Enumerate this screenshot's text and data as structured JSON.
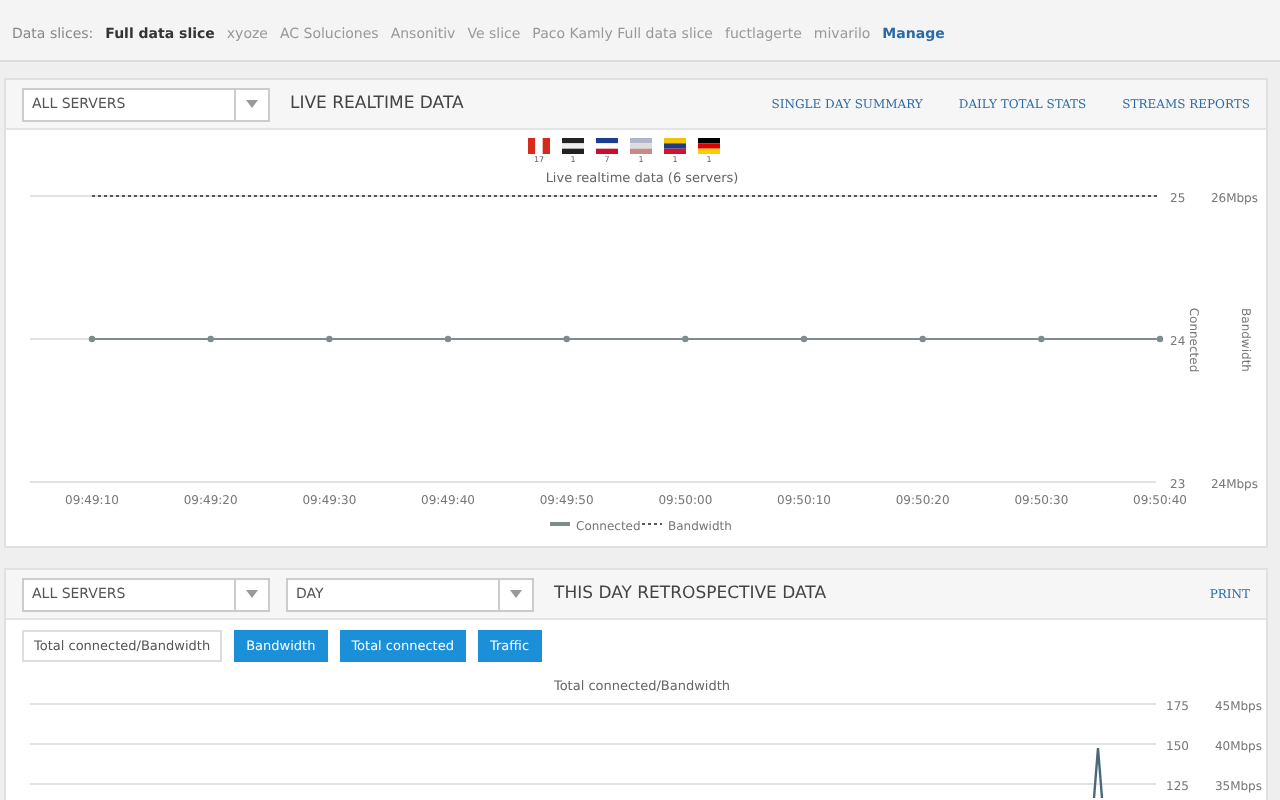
{
  "slices": {
    "label": "Data slices:",
    "items": [
      {
        "text": "Full data slice",
        "kind": "current"
      },
      {
        "text": "xyoze",
        "kind": "slice"
      },
      {
        "text": "AC Soluciones",
        "kind": "slice"
      },
      {
        "text": "Ansonitiv",
        "kind": "slice"
      },
      {
        "text": "Ve slice",
        "kind": "slice"
      },
      {
        "text": "Paco Kamly Full data slice",
        "kind": "slice"
      },
      {
        "text": "fuctlagerte",
        "kind": "slice"
      },
      {
        "text": "mivarilo",
        "kind": "slice"
      },
      {
        "text": "Manage",
        "kind": "manage"
      }
    ]
  },
  "live": {
    "server_select": "ALL SERVERS",
    "title": "LIVE REALTIME DATA",
    "links": [
      "SINGLE DAY SUMMARY",
      "DAILY TOTAL STATS",
      "STREAMS REPORTS"
    ],
    "flags": [
      {
        "kind": "canada",
        "count": "17"
      },
      {
        "kind": "puerto-rico",
        "count": "1"
      },
      {
        "kind": "dominican",
        "count": "7"
      },
      {
        "kind": "usa",
        "count": "1"
      },
      {
        "kind": "venezuela",
        "count": "1"
      },
      {
        "kind": "germany",
        "count": "1"
      }
    ],
    "chart_data": {
      "type": "line",
      "title": "Live realtime data (6 servers)",
      "categories": [
        "09:49:10",
        "09:49:20",
        "09:49:30",
        "09:49:40",
        "09:49:50",
        "09:50:00",
        "09:50:10",
        "09:50:20",
        "09:50:30",
        "09:50:40"
      ],
      "ylim": [
        23,
        25
      ],
      "yticks": [
        23,
        24,
        25
      ],
      "ylabel": "Connected",
      "y2label": "Bandwidth",
      "y2ticks": [
        "24Mbps",
        "26Mbps"
      ],
      "legend": true,
      "series": [
        {
          "name": "Connected",
          "color": "#7f8c8d",
          "marker": "circle",
          "line_style": "solid",
          "values": [
            24,
            24,
            24,
            24,
            24,
            24,
            24,
            24,
            24,
            24
          ]
        },
        {
          "name": "Bandwidth",
          "color": "#555555",
          "marker": "none",
          "line_style": "dotted",
          "values": [
            25,
            25,
            25,
            25,
            25,
            25,
            25,
            25,
            25,
            25
          ]
        }
      ]
    }
  },
  "retro": {
    "server_select": "ALL SERVERS",
    "period_select": "DAY",
    "title": "THIS DAY RETROSPECTIVE DATA",
    "print": "PRINT",
    "buttons": [
      {
        "label": "Total connected/Bandwidth",
        "selected": true
      },
      {
        "label": "Bandwidth",
        "selected": false
      },
      {
        "label": "Total connected",
        "selected": false
      },
      {
        "label": "Traffic",
        "selected": false
      }
    ],
    "chart_title": "Total connected/Bandwidth",
    "left_ticks": [
      "175",
      "150",
      "125"
    ],
    "right_ticks": [
      "45Mbps",
      "40Mbps",
      "35Mbps"
    ]
  }
}
